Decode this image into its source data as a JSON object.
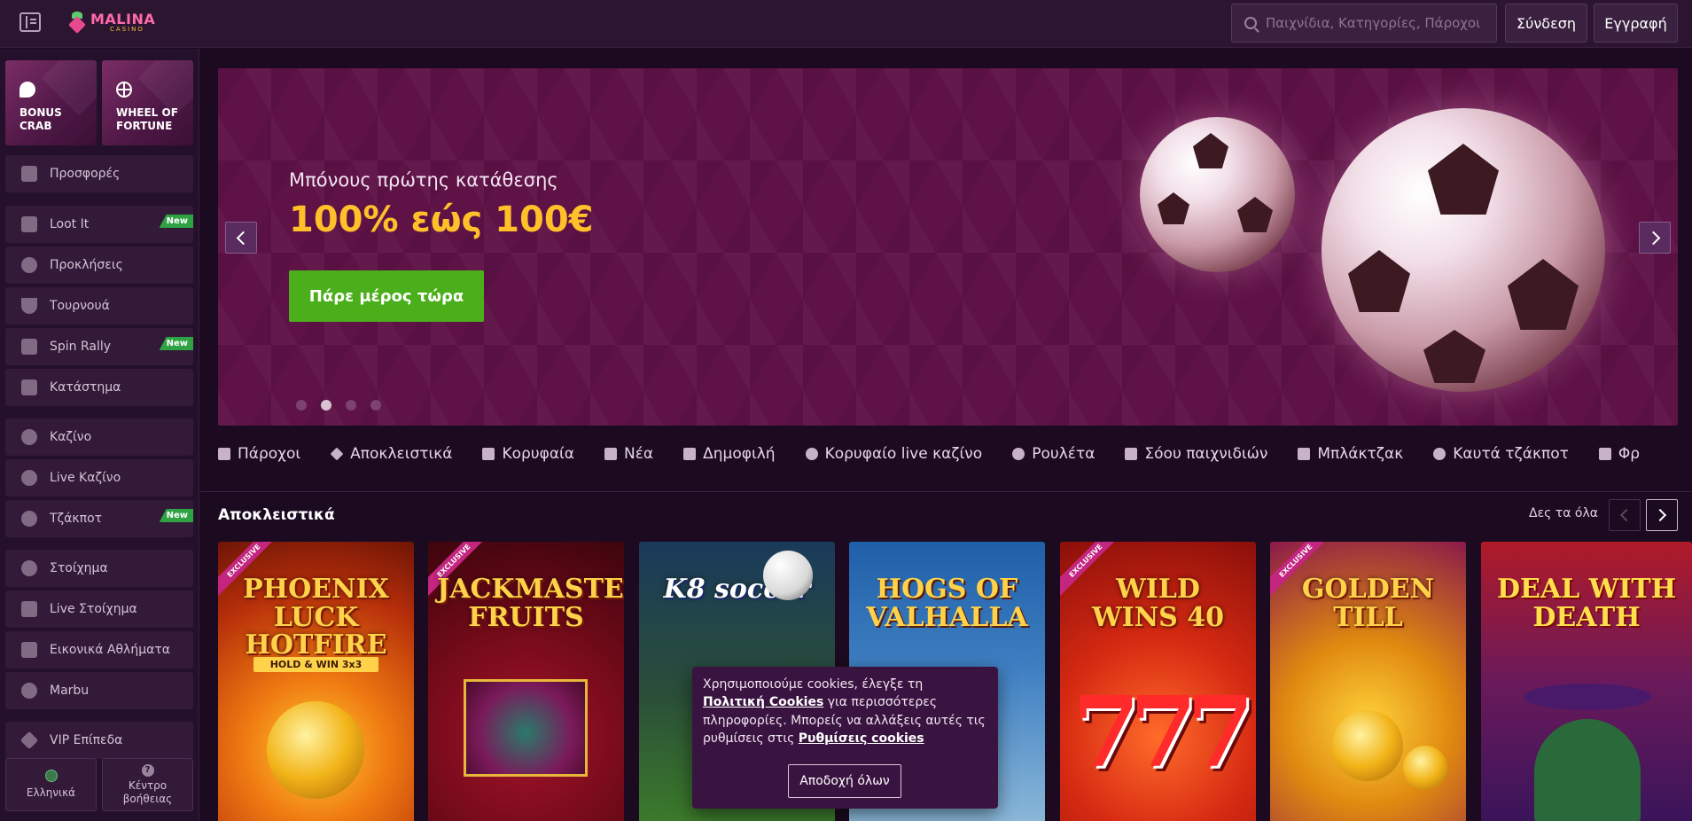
{
  "header": {
    "logo_text": "MALINA",
    "logo_subtext": "CASINO",
    "search_placeholder": "Παιχνίδια, Κατηγορίες, Πάροχοι",
    "login_label": "Σύνδεση",
    "register_label": "Εγγραφή"
  },
  "sidebar": {
    "tiles": [
      {
        "label": "BONUS CRAB",
        "icon": "crab-icon"
      },
      {
        "label": "WHEEL OF FORTUNE",
        "icon": "wheel-icon"
      }
    ],
    "items": [
      {
        "label": "Προσφορές",
        "icon": "gift-icon",
        "badge": ""
      },
      {
        "label": "Loot It",
        "icon": "chest-icon",
        "badge": "New"
      },
      {
        "label": "Προκλήσεις",
        "icon": "medal-icon",
        "badge": ""
      },
      {
        "label": "Τουρνουά",
        "icon": "trophy-icon",
        "badge": ""
      },
      {
        "label": "Spin Rally",
        "icon": "rally-icon",
        "badge": "New"
      },
      {
        "label": "Κατάστημα",
        "icon": "store-icon",
        "badge": ""
      },
      {
        "label": "Καζίνο",
        "icon": "casino-icon",
        "badge": ""
      },
      {
        "label": "Live Καζίνο",
        "icon": "roulette-icon",
        "badge": ""
      },
      {
        "label": "Τζάκποτ",
        "icon": "jackpot-icon",
        "badge": "New"
      },
      {
        "label": "Στοίχημα",
        "icon": "ball-icon",
        "badge": ""
      },
      {
        "label": "Live Στοίχημα",
        "icon": "live-bet-icon",
        "badge": ""
      },
      {
        "label": "Εικονικά Αθλήματα",
        "icon": "virtual-icon",
        "badge": ""
      },
      {
        "label": "Marbu",
        "icon": "marbu-icon",
        "badge": ""
      },
      {
        "label": "VIP Επίπεδα",
        "icon": "diamond-icon",
        "badge": ""
      }
    ],
    "language_label": "Ελληνικά",
    "help_label": "Κέντρο βοήθειας"
  },
  "banner": {
    "subtitle": "Μπόνους πρώτης κατάθεσης",
    "title": "100% εώς 100€",
    "cta_label": "Πάρε μέρος τώρα",
    "slide_count": 4,
    "active_slide": 2
  },
  "tabs": [
    {
      "label": "Πάροχοι",
      "icon": "grid-icon"
    },
    {
      "label": "Αποκλειστικά",
      "icon": "gem-icon"
    },
    {
      "label": "Κορυφαία",
      "icon": "podium-icon"
    },
    {
      "label": "Νέα",
      "icon": "new-icon"
    },
    {
      "label": "Δημοφιλή",
      "icon": "bolt-icon"
    },
    {
      "label": "Κορυφαίο live καζίνο",
      "icon": "chip-icon"
    },
    {
      "label": "Ρουλέτα",
      "icon": "roulette-icon"
    },
    {
      "label": "Σόου παιχνιδιών",
      "icon": "show-icon"
    },
    {
      "label": "Μπλάκτζακ",
      "icon": "cards-icon"
    },
    {
      "label": "Καυτά τζάκποτ",
      "icon": "flame-icon"
    },
    {
      "label": "Φρ",
      "icon": "fruit-icon"
    }
  ],
  "exclusives": {
    "title": "Αποκλειστικά",
    "see_all_label": "Δες τα όλα",
    "exclusive_ribbon": "EXCLUSIVE",
    "games": [
      {
        "name": "PHOENIX LUCK HOTFIRE",
        "sub": "HOLD & WIN 3x3",
        "exclusive": true
      },
      {
        "name": "JACKMASTER FRUITS",
        "sub": "",
        "exclusive": true
      },
      {
        "name": "K8 soccer",
        "sub": "",
        "exclusive": false
      },
      {
        "name": "HOGS OF VALHALLA",
        "sub": "",
        "exclusive": false
      },
      {
        "name": "WILD WINS 40",
        "sub": "",
        "exclusive": true
      },
      {
        "name": "GOLDEN TILL",
        "sub": "",
        "exclusive": true
      },
      {
        "name": "DEAL WITH DEATH",
        "sub": "",
        "exclusive": false
      }
    ]
  },
  "cookie": {
    "text_1": "Χρησιμοποιούμε cookies, έλεγξε τη ",
    "link_1": "Πολιτική Cookies",
    "text_2": " για περισσότερες πληροφορίες. Μπορείς να αλλάξεις αυτές τις ρυθμίσεις στις ",
    "link_2": "Ρυθμίσεις cookies",
    "accept_label": "Αποδοχή όλων"
  },
  "colors": {
    "background": "#1c0a20",
    "banner": "#5e1246",
    "accent_yellow": "#ffc02a",
    "cta_green": "#4aaf1b",
    "new_badge": "#2fa344"
  }
}
